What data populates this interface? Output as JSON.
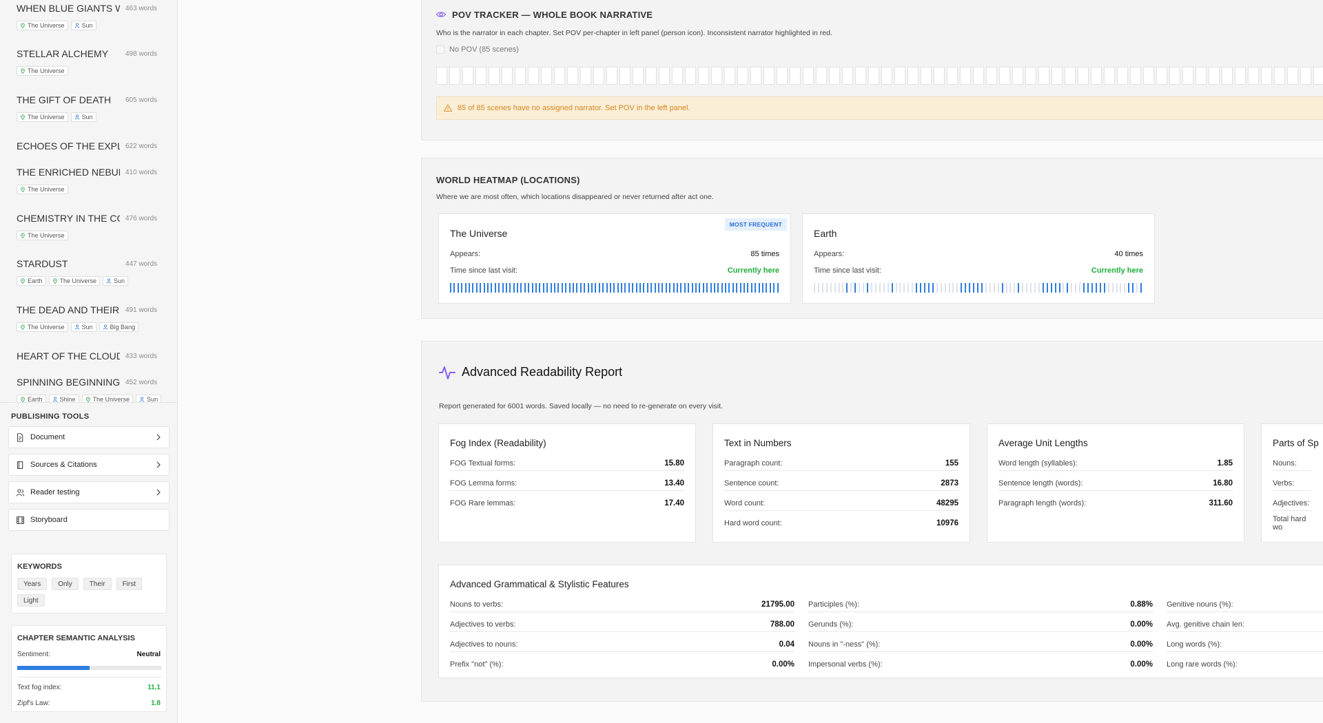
{
  "sidebar": {
    "chapters": [
      {
        "title": "WHEN BLUE GIANTS WE",
        "words": "463 words",
        "tags": [
          {
            "type": "loc",
            "label": "The Universe"
          },
          {
            "type": "person",
            "label": "Sun"
          }
        ]
      },
      {
        "title": "STELLAR ALCHEMY",
        "words": "498 words",
        "tags": [
          {
            "type": "loc",
            "label": "The Universe"
          }
        ]
      },
      {
        "title": "THE GIFT OF DEATH",
        "words": "605 words",
        "tags": [
          {
            "type": "loc",
            "label": "The Universe"
          },
          {
            "type": "person",
            "label": "Sun"
          }
        ]
      },
      {
        "title": "ECHOES OF THE EXPLOS",
        "words": "622 words",
        "tags": []
      },
      {
        "title": "THE ENRICHED NEBULA",
        "words": "410 words",
        "tags": [
          {
            "type": "loc",
            "label": "The Universe"
          }
        ]
      },
      {
        "title": "CHEMISTRY IN THE COLI",
        "words": "476 words",
        "tags": [
          {
            "type": "loc",
            "label": "The Universe"
          }
        ]
      },
      {
        "title": "STARDUST",
        "words": "447 words",
        "tags": [
          {
            "type": "loc",
            "label": "Earth"
          },
          {
            "type": "loc",
            "label": "The Universe"
          },
          {
            "type": "person",
            "label": "Sun"
          }
        ]
      },
      {
        "title": "THE DEAD AND THEIR LE",
        "words": "491 words",
        "tags": [
          {
            "type": "loc",
            "label": "The Universe"
          },
          {
            "type": "person",
            "label": "Sun"
          },
          {
            "type": "person",
            "label": "Big Bang"
          }
        ]
      },
      {
        "title": "HEART OF THE CLOUD",
        "words": "433 words",
        "tags": []
      },
      {
        "title": "SPINNING BEGINNINGS",
        "words": "452 words",
        "tags": [
          {
            "type": "loc",
            "label": "Earth"
          },
          {
            "type": "person",
            "label": "Shine"
          },
          {
            "type": "loc",
            "label": "The Universe"
          },
          {
            "type": "person",
            "label": "Sun"
          }
        ]
      }
    ],
    "publishing_tools": {
      "label": "PUBLISHING TOOLS",
      "items": [
        {
          "label": "Document",
          "icon": "document-icon",
          "chevron": true
        },
        {
          "label": "Sources & Citations",
          "icon": "book-icon",
          "chevron": true
        },
        {
          "label": "Reader testing",
          "icon": "users-icon",
          "chevron": true
        },
        {
          "label": "Storyboard",
          "icon": "film-icon",
          "chevron": false
        }
      ]
    },
    "keywords": {
      "label": "KEYWORDS",
      "items": [
        "Years",
        "Only",
        "Their",
        "First",
        "Light"
      ]
    },
    "semantic": {
      "label": "CHAPTER SEMANTIC ANALYSIS",
      "sentiment_label": "Sentiment:",
      "sentiment_value": "Neutral",
      "sentiment_level": 0.5,
      "fog_label": "Text fog index:",
      "fog_value": "11.1",
      "zipf_label": "Zipf's Law:",
      "zipf_value": "1.8",
      "accent": "#1fae3c",
      "bar_color": "#2f7de1"
    }
  },
  "pov": {
    "title": "POV TRACKER — WHOLE BOOK NARRATIVE",
    "description": "Who is the narrator in each chapter. Set POV per-chapter in left panel (person icon). Inconsistent narrator highlighted in red.",
    "legend": "No POV (85 scenes)",
    "scene_count": 85,
    "warning": "85 of 85 scenes have no assigned narrator. Set POV in the left panel.",
    "accent": "#8b5cf6"
  },
  "heatmap": {
    "title": "WORLD HEATMAP (LOCATIONS)",
    "description": "Where we are most often, which locations disappeared or never returned after act one.",
    "locations": [
      {
        "name": "The Universe",
        "badge": "MOST FREQUENT",
        "appears_label": "Appears:",
        "appears": "85 times",
        "since_label": "Time since last visit:",
        "since": "Currently here",
        "presence": "11111111111111111111111111111111111111111111111111111111111111111111111111111111111111111"
      },
      {
        "name": "Earth",
        "badge": "",
        "appears_label": "Appears:",
        "appears": "40 times",
        "since_label": "Time since last visit:",
        "since": "Currently here",
        "presence": "000000001010010000010000011111000000111111000010001000001111101000111111000001101"
      }
    ],
    "bar_color": "#2f7de1"
  },
  "readability": {
    "title": "Advanced Readability Report",
    "description": "Report generated for 6001 words. Saved locally — no need to re-generate on every visit.",
    "accent": "#8b5cf6",
    "cards": [
      {
        "title": "Fog Index (Readability)",
        "rows": [
          [
            "FOG Textual forms:",
            "15.80"
          ],
          [
            "FOG Lemma forms:",
            "13.40"
          ],
          [
            "FOG Rare lemmas:",
            "17.40"
          ]
        ]
      },
      {
        "title": "Text in Numbers",
        "rows": [
          [
            "Paragraph count:",
            "155"
          ],
          [
            "Sentence count:",
            "2873"
          ],
          [
            "Word count:",
            "48295"
          ],
          [
            "Hard word count:",
            "10976"
          ]
        ]
      },
      {
        "title": "Average Unit Lengths",
        "rows": [
          [
            "Word length (syllables):",
            "1.85"
          ],
          [
            "Sentence length (words):",
            "16.80"
          ],
          [
            "Paragraph length (words):",
            "311.60"
          ]
        ]
      },
      {
        "title": "Parts of Sp",
        "rows": [
          [
            "Nouns:",
            ""
          ],
          [
            "Verbs:",
            ""
          ],
          [
            "Adjectives:",
            ""
          ],
          [
            "Total hard wo",
            ""
          ]
        ]
      }
    ],
    "grammar": {
      "title": "Advanced Grammatical & Stylistic Features",
      "columns": [
        [
          [
            "Nouns to verbs:",
            "21795.00"
          ],
          [
            "Adjectives to verbs:",
            "788.00"
          ],
          [
            "Adjectives to nouns:",
            "0.04"
          ],
          [
            "Prefix \"not\" (%):",
            "0.00%"
          ]
        ],
        [
          [
            "Participles (%):",
            "0.88%"
          ],
          [
            "Gerunds (%):",
            "0.00%"
          ],
          [
            "Nouns in \"-ness\" (%):",
            "0.00%"
          ],
          [
            "Impersonal verbs (%):",
            "0.00%"
          ]
        ],
        [
          [
            "Genitive nouns (%):",
            ""
          ],
          [
            "Avg. genitive chain len:",
            ""
          ],
          [
            "Long words (%):",
            ""
          ],
          [
            "Long rare words (%):",
            ""
          ]
        ]
      ]
    }
  }
}
